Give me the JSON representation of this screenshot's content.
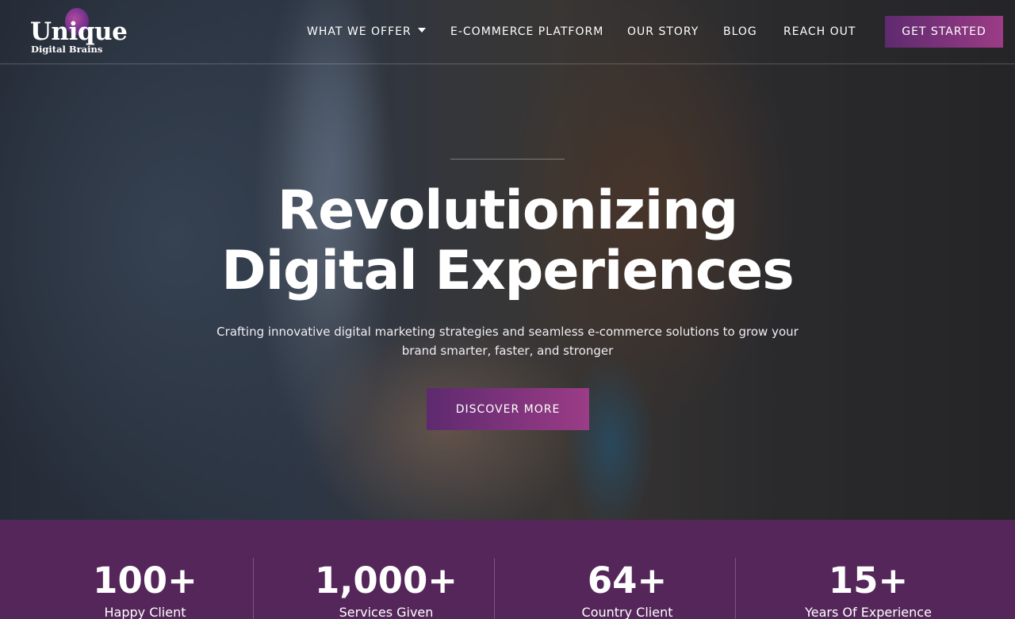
{
  "brand": {
    "logo_word": "Unique",
    "logo_tagline": "Digital Brains"
  },
  "nav": {
    "items": [
      {
        "label": "WHAT WE OFFER",
        "has_dropdown": true
      },
      {
        "label": "E-COMMERCE PLATFORM"
      },
      {
        "label": "OUR STORY"
      },
      {
        "label": "BLOG"
      },
      {
        "label": "REACH OUT"
      }
    ],
    "cta_label": "GET STARTED"
  },
  "hero": {
    "headline_line1": "Revolutionizing",
    "headline_line2": "Digital Experiences",
    "subtext": "Crafting innovative digital marketing strategies and seamless e-commerce solutions to grow your brand smarter, faster, and stronger",
    "button_label": "DISCOVER MORE"
  },
  "stats": [
    {
      "value": "100+",
      "label": "Happy Client"
    },
    {
      "value": "1,000+",
      "label": "Services Given"
    },
    {
      "value": "64+",
      "label": "Country Client"
    },
    {
      "value": "15+",
      "label": "Years Of Experience"
    }
  ],
  "colors": {
    "accent_start": "#5e2a6f",
    "accent_end": "#9b3c86",
    "stats_background": "#55265a"
  }
}
